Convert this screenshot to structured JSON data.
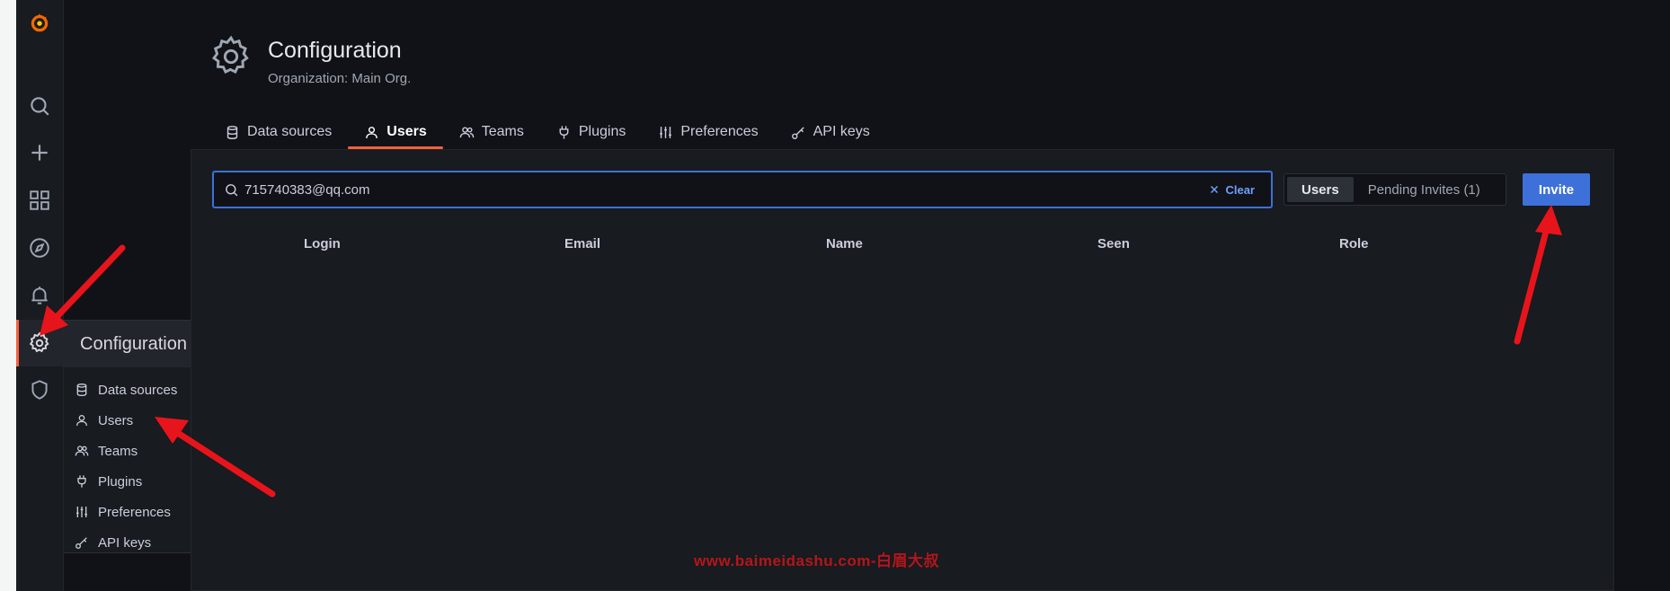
{
  "sidebar": {
    "icons": [
      "grafana-logo-icon",
      "search-icon",
      "plus-icon",
      "dashboards-icon",
      "explore-icon",
      "alerting-icon",
      "gear-icon",
      "shield-icon"
    ]
  },
  "flyout": {
    "title": "Configuration",
    "items": [
      {
        "label": "Data sources",
        "icon": "database-icon"
      },
      {
        "label": "Users",
        "icon": "user-icon"
      },
      {
        "label": "Teams",
        "icon": "users-icon"
      },
      {
        "label": "Plugins",
        "icon": "plug-icon"
      },
      {
        "label": "Preferences",
        "icon": "sliders-icon"
      },
      {
        "label": "API keys",
        "icon": "key-icon"
      }
    ]
  },
  "header": {
    "title": "Configuration",
    "subtitle": "Organization: Main Org."
  },
  "tabs": [
    {
      "label": "Data sources",
      "icon": "database-icon"
    },
    {
      "label": "Users",
      "icon": "user-icon",
      "active": true
    },
    {
      "label": "Teams",
      "icon": "users-icon"
    },
    {
      "label": "Plugins",
      "icon": "plug-icon"
    },
    {
      "label": "Preferences",
      "icon": "sliders-icon"
    },
    {
      "label": "API keys",
      "icon": "key-icon"
    }
  ],
  "search": {
    "value": "715740383@qq.com",
    "clear_label": "Clear"
  },
  "segmented": {
    "users_label": "Users",
    "pending_label": "Pending Invites (1)"
  },
  "invite_label": "Invite",
  "table": {
    "columns": [
      "Login",
      "Email",
      "Name",
      "Seen",
      "Role"
    ]
  },
  "watermark": "www.baimeidashu.com-白眉大叔",
  "colors": {
    "accent": "#f55f3e",
    "primary": "#3d71d9",
    "link": "#6e9fff",
    "annotation": "#e8141b"
  }
}
